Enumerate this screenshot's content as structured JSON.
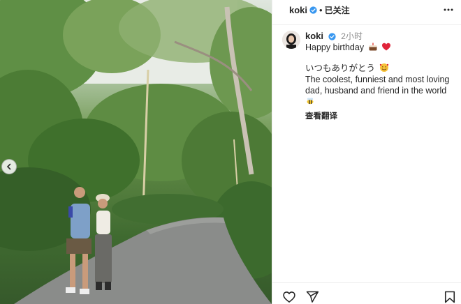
{
  "post": {
    "username": "koki",
    "follow_status": "已关注",
    "separator": "•",
    "time_ago": "2小时",
    "caption": {
      "line1": "Happy birthday",
      "line2": "いつもありがとう",
      "line3": "The coolest, funniest and most loving dad, husband and friend in the world"
    },
    "translate_label": "查看翻译"
  },
  "icons": {
    "verified": "verified-badge-icon",
    "more": "more-options-icon",
    "prev": "chevron-left-icon",
    "like": "heart-icon",
    "share": "send-icon",
    "save": "bookmark-icon",
    "emoji_cake": "cake-emoji",
    "emoji_heart": "red-heart-emoji",
    "emoji_smile": "smiling-face-with-hearts-emoji",
    "emoji_bee": "bee-emoji"
  },
  "colors": {
    "verified_blue": "#3897f0",
    "text": "#262626",
    "muted": "#8e8e8e",
    "divider": "#efefef"
  }
}
